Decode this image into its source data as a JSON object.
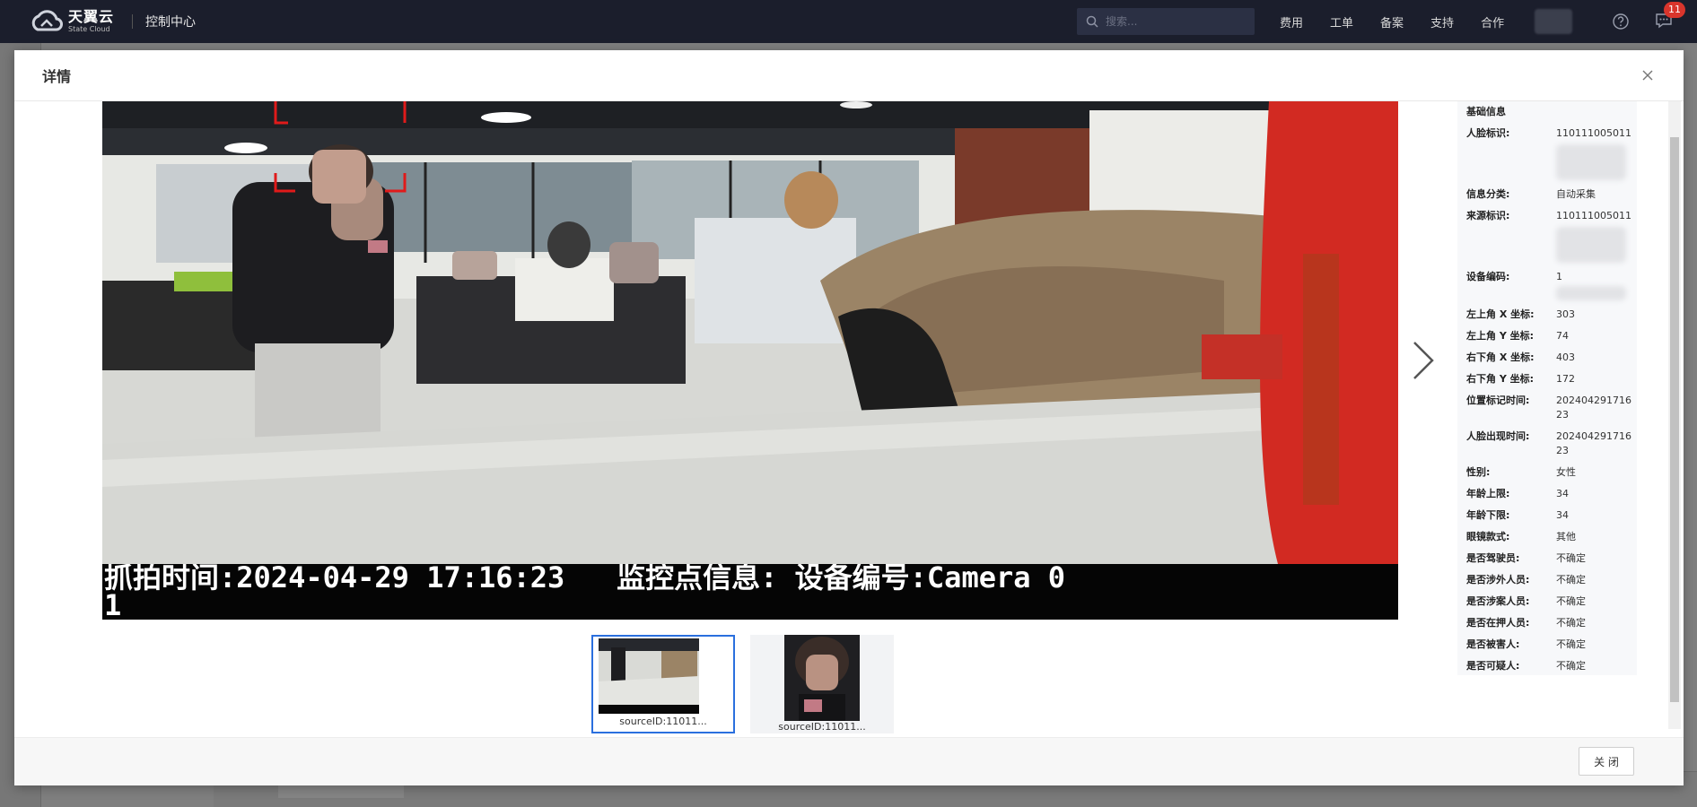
{
  "nav": {
    "logo_cn": "天翼云",
    "logo_en": "State Cloud",
    "console_title": "控制中心",
    "search_placeholder": "搜索...",
    "links": [
      "费用",
      "工单",
      "备案",
      "支持",
      "合作"
    ],
    "message_count": "11"
  },
  "modal": {
    "title": "详情",
    "close_button": "关 闭"
  },
  "photo": {
    "osd_line1": "抓拍时间:2024-04-29 17:16:23   监控点信息: 设备编号:Camera 0",
    "osd_line2": "1"
  },
  "thumbnails": [
    {
      "caption": "sourceID:11011...",
      "selected": true
    },
    {
      "caption": "sourceID:11011...",
      "selected": false
    }
  ],
  "info": {
    "section_title": "基础信息",
    "rows": [
      {
        "label": "人脸标识:",
        "value": "110111005011"
      },
      {
        "label": "信息分类:",
        "value": "自动采集"
      },
      {
        "label": "来源标识:",
        "value": "110111005011"
      },
      {
        "label": "设备编码:",
        "value": "1"
      },
      {
        "label": "左上角 X 坐标:",
        "value": "303"
      },
      {
        "label": "左上角 Y 坐标:",
        "value": "74"
      },
      {
        "label": "右下角 X 坐标:",
        "value": "403"
      },
      {
        "label": "右下角 Y 坐标:",
        "value": "172"
      },
      {
        "label": "位置标记时间:",
        "value": "20240429171623"
      },
      {
        "label": "人脸出现时间:",
        "value": "20240429171623"
      },
      {
        "label": "性别:",
        "value": "女性"
      },
      {
        "label": "年龄上限:",
        "value": "34"
      },
      {
        "label": "年龄下限:",
        "value": "34"
      },
      {
        "label": "眼镜款式:",
        "value": "其他"
      },
      {
        "label": "是否驾驶员:",
        "value": "不确定"
      },
      {
        "label": "是否涉外人员:",
        "value": "不确定"
      },
      {
        "label": "是否涉案人员:",
        "value": "不确定"
      },
      {
        "label": "是否在押人员:",
        "value": "不确定"
      },
      {
        "label": "是否被害人:",
        "value": "不确定"
      },
      {
        "label": "是否可疑人:",
        "value": "不确定"
      }
    ]
  }
}
